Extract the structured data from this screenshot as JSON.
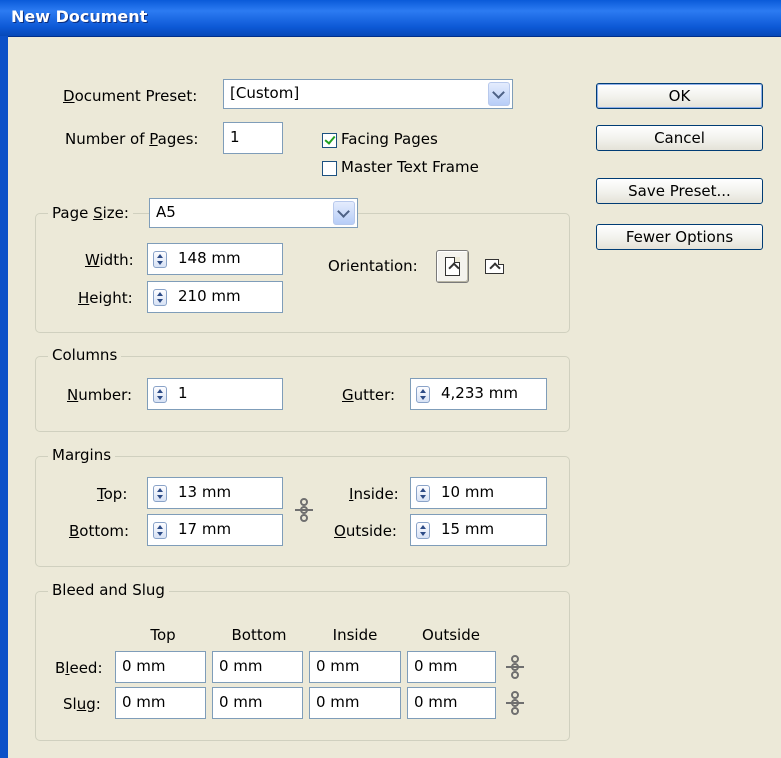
{
  "window": {
    "title": "New Document"
  },
  "preset": {
    "label_pre": "",
    "label_u": "D",
    "label_post": "ocument Preset:",
    "value": "[Custom]"
  },
  "pages": {
    "label_pre": "Number of ",
    "label_u": "P",
    "label_post": "ages:",
    "value": "1"
  },
  "facing_pages": {
    "label": "Facing Pages",
    "checked": true
  },
  "master_text_frame": {
    "label": "Master Text Frame",
    "checked": false
  },
  "buttons": {
    "ok": "OK",
    "cancel": "Cancel",
    "save_preset": "Save Preset...",
    "fewer_options": "Fewer Options"
  },
  "page_size": {
    "label_pre": "Page ",
    "label_u": "S",
    "label_post": "ize:",
    "value": "A5",
    "width_label_u": "W",
    "width_label_post": "idth:",
    "width": "148 mm",
    "height_label_u": "H",
    "height_label_post": "eight:",
    "height": "210 mm",
    "orientation_label": "Orientation:"
  },
  "columns": {
    "title": "Columns",
    "number_label_u": "N",
    "number_label_post": "umber:",
    "number": "1",
    "gutter_label_u": "G",
    "gutter_label_post": "utter:",
    "gutter": "4,233 mm"
  },
  "margins": {
    "title": "Margins",
    "top_label_u": "T",
    "top_label_post": "op:",
    "top": "13 mm",
    "bottom_label_u": "B",
    "bottom_label_post": "ottom:",
    "bottom": "17 mm",
    "inside_label_u": "I",
    "inside_label_post": "nside:",
    "inside": "10 mm",
    "outside_label_u": "O",
    "outside_label_post": "utside:",
    "outside": "15 mm"
  },
  "bleed_slug": {
    "title": "Bleed and Slug",
    "headers": [
      "Top",
      "Bottom",
      "Inside",
      "Outside"
    ],
    "bleed_label_pre": "B",
    "bleed_label_u": "l",
    "bleed_label_post": "eed:",
    "bleed": [
      "0 mm",
      "0 mm",
      "0 mm",
      "0 mm"
    ],
    "slug_label_pre": "Sl",
    "slug_label_u": "u",
    "slug_label_post": "g:",
    "slug": [
      "0 mm",
      "0 mm",
      "0 mm",
      "0 mm"
    ]
  }
}
